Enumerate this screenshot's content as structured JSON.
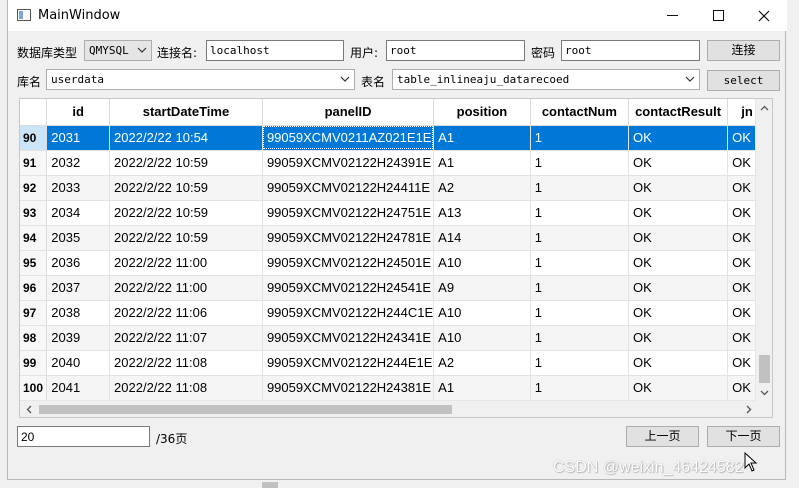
{
  "window": {
    "title": "MainWindow"
  },
  "connection": {
    "db_type_label": "数据库类型",
    "db_type_value": "QMYSQL",
    "conn_name_label": "连接名:",
    "conn_name_value": "localhost",
    "user_label": "用户:",
    "user_value": "root",
    "password_label": "密码",
    "password_value": "root",
    "connect_button": "连接"
  },
  "selection": {
    "db_label": "库名",
    "db_value": "userdata",
    "table_label": "表名",
    "table_value": "table_inlineaju_datarecoed",
    "select_button": "select"
  },
  "table": {
    "columns": [
      "id",
      "startDateTime",
      "panelID",
      "position",
      "contactNum",
      "contactResult",
      "jn"
    ],
    "rows": [
      {
        "row": "90",
        "id": "2031",
        "start": "2022/2/22 10:54",
        "panel": "99059XCMV0211AZ021E1E",
        "pos": "A1",
        "num": "1",
        "result": "OK",
        "jn": "OK"
      },
      {
        "row": "91",
        "id": "2032",
        "start": "2022/2/22 10:59",
        "panel": "99059XCMV02122H24391E",
        "pos": "A1",
        "num": "1",
        "result": "OK",
        "jn": "OK"
      },
      {
        "row": "92",
        "id": "2033",
        "start": "2022/2/22 10:59",
        "panel": "99059XCMV02122H24411E",
        "pos": "A2",
        "num": "1",
        "result": "OK",
        "jn": "OK"
      },
      {
        "row": "93",
        "id": "2034",
        "start": "2022/2/22 10:59",
        "panel": "99059XCMV02122H24751E",
        "pos": "A13",
        "num": "1",
        "result": "OK",
        "jn": "OK"
      },
      {
        "row": "94",
        "id": "2035",
        "start": "2022/2/22 10:59",
        "panel": "99059XCMV02122H24781E",
        "pos": "A14",
        "num": "1",
        "result": "OK",
        "jn": "OK"
      },
      {
        "row": "95",
        "id": "2036",
        "start": "2022/2/22 11:00",
        "panel": "99059XCMV02122H24501E",
        "pos": "A10",
        "num": "1",
        "result": "OK",
        "jn": "OK"
      },
      {
        "row": "96",
        "id": "2037",
        "start": "2022/2/22 11:00",
        "panel": "99059XCMV02122H24541E",
        "pos": "A9",
        "num": "1",
        "result": "OK",
        "jn": "OK"
      },
      {
        "row": "97",
        "id": "2038",
        "start": "2022/2/22 11:06",
        "panel": "99059XCMV02122H244C1E",
        "pos": "A10",
        "num": "1",
        "result": "OK",
        "jn": "OK"
      },
      {
        "row": "98",
        "id": "2039",
        "start": "2022/2/22 11:07",
        "panel": "99059XCMV02122H24341E",
        "pos": "A10",
        "num": "1",
        "result": "OK",
        "jn": "OK"
      },
      {
        "row": "99",
        "id": "2040",
        "start": "2022/2/22 11:08",
        "panel": "99059XCMV02122H244E1E",
        "pos": "A2",
        "num": "1",
        "result": "OK",
        "jn": "OK"
      },
      {
        "row": "100",
        "id": "2041",
        "start": "2022/2/22 11:08",
        "panel": "99059XCMV02122H24381E",
        "pos": "A1",
        "num": "1",
        "result": "OK",
        "jn": "OK"
      }
    ],
    "selected_row": "90"
  },
  "pagination": {
    "page_value": "20",
    "total_pages": "/36页",
    "prev_button": "上一页",
    "next_button": "下一页"
  },
  "watermark": "CSDN @weixin_46424582"
}
